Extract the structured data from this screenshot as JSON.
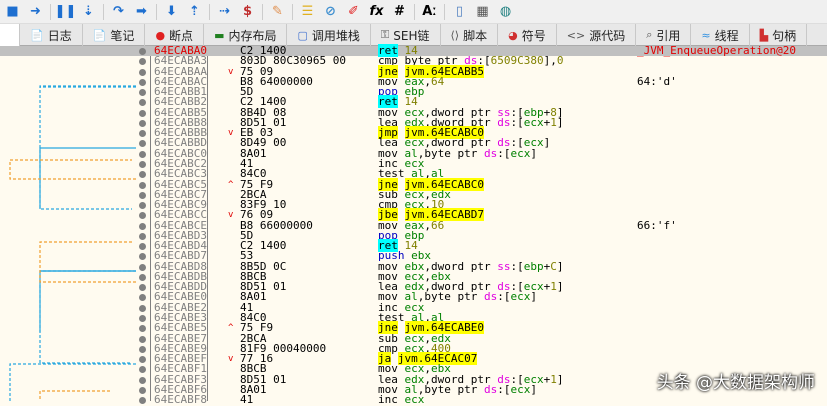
{
  "toolbar": {
    "icons": [
      "stop-icon",
      "run-icon",
      "pause-icon",
      "step-into-icon",
      "step-over-icon",
      "trace-into-icon",
      "trace-over-icon",
      "execute-till-return-icon",
      "run-to-user-code-icon",
      "script-icon",
      "patch-icon",
      "comment-icon",
      "attach-icon",
      "highlight-icon",
      "fx-icon",
      "hash-icon",
      "font-icon",
      "device-icon",
      "calculator-icon",
      "globe-icon"
    ],
    "fx": "fx",
    "hash": "#",
    "az": "Aː"
  },
  "tabs": [
    {
      "label": "日志",
      "icon": "log-icon"
    },
    {
      "label": "笔记",
      "icon": "notes-icon"
    },
    {
      "label": "断点",
      "icon": "breakpoint-icon"
    },
    {
      "label": "内存布局",
      "icon": "memory-map-icon"
    },
    {
      "label": "调用堆栈",
      "icon": "call-stack-icon"
    },
    {
      "label": "SEH链",
      "icon": "seh-icon"
    },
    {
      "label": "脚本",
      "icon": "script-icon"
    },
    {
      "label": "符号",
      "icon": "symbols-icon"
    },
    {
      "label": "源代码",
      "icon": "source-icon"
    },
    {
      "label": "引用",
      "icon": "references-icon"
    },
    {
      "label": "线程",
      "icon": "threads-icon"
    },
    {
      "label": "句柄",
      "icon": "handles-icon"
    }
  ],
  "rows": [
    {
      "addr": "64ECABA0",
      "bytes": "C2 1400",
      "mn": "ret",
      "ops": "14",
      "cmt": "_JVM_EnqueueOperation@20",
      "sel": true
    },
    {
      "addr": "64ECABA3",
      "bytes": "803D 80C30965 00",
      "mn": "cmp",
      "ops": "byte ptr ds:[6509C380],0"
    },
    {
      "addr": "64ECABAA",
      "bytes": "75 09",
      "mn": "jne",
      "ops": "jvm.64ECABB5",
      "arr": "down"
    },
    {
      "addr": "64ECABAC",
      "bytes": "B8 64000000",
      "mn": "mov",
      "ops": "eax,64",
      "cmt": "64:'d'"
    },
    {
      "addr": "64ECABB1",
      "bytes": "5D",
      "mn": "pop",
      "ops": "ebp"
    },
    {
      "addr": "64ECABB2",
      "bytes": "C2 1400",
      "mn": "ret",
      "ops": "14"
    },
    {
      "addr": "64ECABB5",
      "bytes": "8B4D 08",
      "mn": "mov",
      "ops": "ecx,dword ptr ss:[ebp+8]"
    },
    {
      "addr": "64ECABB8",
      "bytes": "8D51 01",
      "mn": "lea",
      "ops": "edx,dword ptr ds:[ecx+1]"
    },
    {
      "addr": "64ECABBB",
      "bytes": "EB 03",
      "mn": "jmp",
      "ops": "jvm.64ECABC0",
      "arr": "down"
    },
    {
      "addr": "64ECABBD",
      "bytes": "8D49 00",
      "mn": "lea",
      "ops": "ecx,dword ptr ds:[ecx]"
    },
    {
      "addr": "64ECABC0",
      "bytes": "8A01",
      "mn": "mov",
      "ops": "al,byte ptr ds:[ecx]"
    },
    {
      "addr": "64ECABC2",
      "bytes": "41",
      "mn": "inc",
      "ops": "ecx"
    },
    {
      "addr": "64ECABC3",
      "bytes": "84C0",
      "mn": "test",
      "ops": "al,al"
    },
    {
      "addr": "64ECABC5",
      "bytes": "75 F9",
      "mn": "jne",
      "ops": "jvm.64ECABC0",
      "arr": "up"
    },
    {
      "addr": "64ECABC7",
      "bytes": "2BCA",
      "mn": "sub",
      "ops": "ecx,edx"
    },
    {
      "addr": "64ECABC9",
      "bytes": "83F9 10",
      "mn": "cmp",
      "ops": "ecx,10"
    },
    {
      "addr": "64ECABCC",
      "bytes": "76 09",
      "mn": "jbe",
      "ops": "jvm.64ECABD7",
      "arr": "down"
    },
    {
      "addr": "64ECABCE",
      "bytes": "B8 66000000",
      "mn": "mov",
      "ops": "eax,66",
      "cmt": "66:'f'"
    },
    {
      "addr": "64ECABD3",
      "bytes": "5D",
      "mn": "pop",
      "ops": "ebp"
    },
    {
      "addr": "64ECABD4",
      "bytes": "C2 1400",
      "mn": "ret",
      "ops": "14"
    },
    {
      "addr": "64ECABD7",
      "bytes": "53",
      "mn": "push",
      "ops": "ebx"
    },
    {
      "addr": "64ECABD8",
      "bytes": "8B5D 0C",
      "mn": "mov",
      "ops": "ebx,dword ptr ss:[ebp+C]"
    },
    {
      "addr": "64ECABDB",
      "bytes": "8BCB",
      "mn": "mov",
      "ops": "ecx,ebx"
    },
    {
      "addr": "64ECABDD",
      "bytes": "8D51 01",
      "mn": "lea",
      "ops": "edx,dword ptr ds:[ecx+1]"
    },
    {
      "addr": "64ECABE0",
      "bytes": "8A01",
      "mn": "mov",
      "ops": "al,byte ptr ds:[ecx]"
    },
    {
      "addr": "64ECABE2",
      "bytes": "41",
      "mn": "inc",
      "ops": "ecx"
    },
    {
      "addr": "64ECABE3",
      "bytes": "84C0",
      "mn": "test",
      "ops": "al,al"
    },
    {
      "addr": "64ECABE5",
      "bytes": "75 F9",
      "mn": "jne",
      "ops": "jvm.64ECABE0",
      "arr": "up"
    },
    {
      "addr": "64ECABE7",
      "bytes": "2BCA",
      "mn": "sub",
      "ops": "ecx,edx"
    },
    {
      "addr": "64ECABE9",
      "bytes": "81F9 00040000",
      "mn": "cmp",
      "ops": "ecx,400"
    },
    {
      "addr": "64ECABEF",
      "bytes": "77 16",
      "mn": "ja",
      "ops": "jvm.64ECAC07",
      "arr": "down"
    },
    {
      "addr": "64ECABF1",
      "bytes": "8BCB",
      "mn": "mov",
      "ops": "ecx,ebx"
    },
    {
      "addr": "64ECABF3",
      "bytes": "8D51 01",
      "mn": "lea",
      "ops": "edx,dword ptr ds:[ecx+1]"
    },
    {
      "addr": "64ECABF6",
      "bytes": "8A01",
      "mn": "mov",
      "ops": "al,byte ptr ds:[ecx]"
    },
    {
      "addr": "64ECABF8",
      "bytes": "41",
      "mn": "inc",
      "ops": "ecx"
    }
  ],
  "watermark": "头条 @大数据架构师"
}
